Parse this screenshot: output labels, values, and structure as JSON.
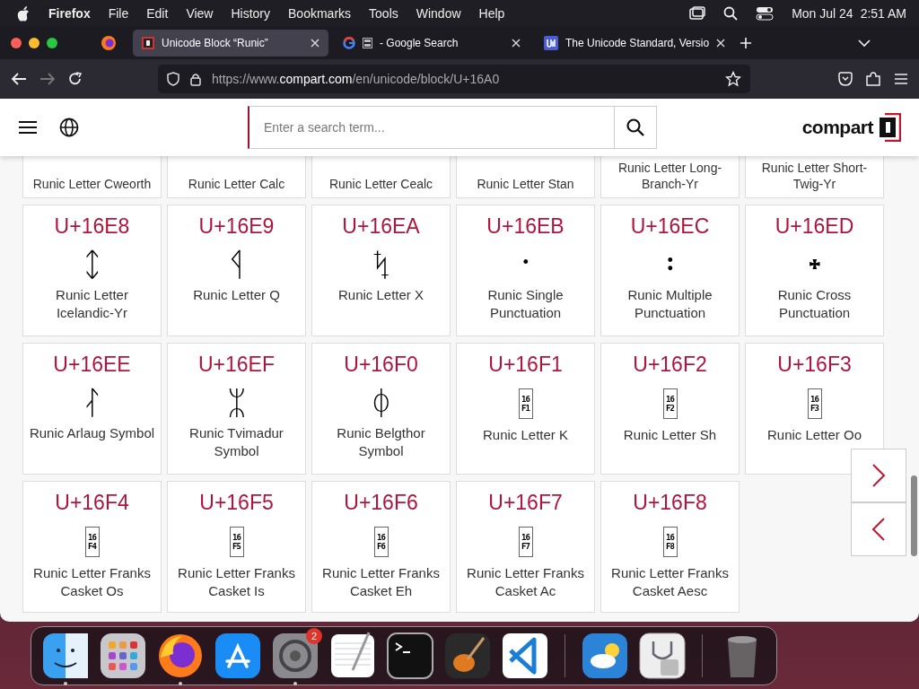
{
  "menubar": {
    "app": "Firefox",
    "items": [
      "File",
      "Edit",
      "View",
      "History",
      "Bookmarks",
      "Tools",
      "Window",
      "Help"
    ],
    "date": "Mon Jul 24",
    "time": "2:51 AM"
  },
  "tabs": [
    {
      "kind": "compart",
      "title": "Unicode Block “Runic”",
      "selected": true
    },
    {
      "kind": "google",
      "title": "- Google Search",
      "selected": false
    },
    {
      "kind": "unicode",
      "title": "The Unicode Standard, Versio",
      "selected": false
    }
  ],
  "address": {
    "prefix": "https://www.",
    "domain": "compart.com",
    "path": "/en/unicode/block/U+16A0"
  },
  "site": {
    "search_placeholder": "Enter a search term...",
    "logo": "compart"
  },
  "partial_row": [
    "Runic Letter Cweorth",
    "Runic Letter Calc",
    "Runic Letter Cealc",
    "Runic Letter Stan",
    "Runic Letter Long-Branch-Yr",
    "Runic Letter Short-Twig-Yr"
  ],
  "cards": [
    {
      "code": "U+16E8",
      "kind": "glyph",
      "glyph": "ᛨ",
      "name": "Runic Letter Icelandic-Yr"
    },
    {
      "code": "U+16E9",
      "kind": "glyph",
      "glyph": "ᛩ",
      "name": "Runic Letter Q"
    },
    {
      "code": "U+16EA",
      "kind": "glyph",
      "glyph": "ᛪ",
      "name": "Runic Letter X"
    },
    {
      "code": "U+16EB",
      "kind": "glyph",
      "glyph": "᛫",
      "name": "Runic Single Punctuation"
    },
    {
      "code": "U+16EC",
      "kind": "glyph",
      "glyph": "᛬",
      "name": "Runic Multiple Punctuation"
    },
    {
      "code": "U+16ED",
      "kind": "glyph",
      "glyph": "᛭",
      "name": "Runic Cross Punctuation"
    },
    {
      "code": "U+16EE",
      "kind": "glyph",
      "glyph": "ᛮ",
      "name": "Runic Arlaug Symbol"
    },
    {
      "code": "U+16EF",
      "kind": "glyph",
      "glyph": "ᛯ",
      "name": "Runic Tvimadur Symbol"
    },
    {
      "code": "U+16F0",
      "kind": "glyph",
      "glyph": "ᛰ",
      "name": "Runic Belgthor Symbol"
    },
    {
      "code": "U+16F1",
      "kind": "hexbox",
      "hex": [
        "16",
        "F1"
      ],
      "name": "Runic Letter K"
    },
    {
      "code": "U+16F2",
      "kind": "hexbox",
      "hex": [
        "16",
        "F2"
      ],
      "name": "Runic Letter Sh"
    },
    {
      "code": "U+16F3",
      "kind": "hexbox",
      "hex": [
        "16",
        "F3"
      ],
      "name": "Runic Letter Oo"
    },
    {
      "code": "U+16F4",
      "kind": "hexbox",
      "hex": [
        "16",
        "F4"
      ],
      "name": "Runic Letter Franks Casket Os"
    },
    {
      "code": "U+16F5",
      "kind": "hexbox",
      "hex": [
        "16",
        "F5"
      ],
      "name": "Runic Letter Franks Casket Is"
    },
    {
      "code": "U+16F6",
      "kind": "hexbox",
      "hex": [
        "16",
        "F6"
      ],
      "name": "Runic Letter Franks Casket Eh"
    },
    {
      "code": "U+16F7",
      "kind": "hexbox",
      "hex": [
        "16",
        "F7"
      ],
      "name": "Runic Letter Franks Casket Ac"
    },
    {
      "code": "U+16F8",
      "kind": "hexbox",
      "hex": [
        "16",
        "F8"
      ],
      "name": "Runic Letter Franks Casket Aesc"
    }
  ],
  "dock": [
    {
      "kind": "finder",
      "running": true
    },
    {
      "kind": "launchpad",
      "running": false
    },
    {
      "kind": "firefox",
      "running": true
    },
    {
      "kind": "appstore",
      "running": false
    },
    {
      "kind": "settings",
      "running": true,
      "badge": "2"
    },
    {
      "kind": "textedit",
      "running": false
    },
    {
      "kind": "terminal",
      "running": false
    },
    {
      "kind": "garageband",
      "running": false
    },
    {
      "kind": "vscode",
      "running": false
    },
    {
      "kind": "separator"
    },
    {
      "kind": "weather",
      "running": false
    },
    {
      "kind": "diskutility",
      "running": false
    },
    {
      "kind": "separator"
    },
    {
      "kind": "trash",
      "running": false
    }
  ]
}
